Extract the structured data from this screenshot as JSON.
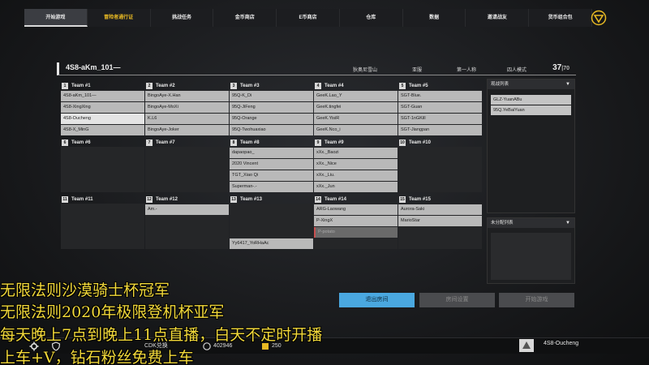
{
  "nav": {
    "tabs": [
      "开始游戏",
      "冒险者通行证",
      "挑战任务",
      "金币商店",
      "E币商店",
      "仓库",
      "数据",
      "邀请战友",
      "货币组合包"
    ],
    "active_index": 0,
    "highlight_index": 1,
    "highlight_color": "#e8b923",
    "logo_icon": "triangle-logo-icon"
  },
  "room": {
    "name": "4S8-aKm_101—",
    "map": "狄奥尼雪山",
    "region": "亚服",
    "perspective": "第一人称",
    "mode": "四人模式",
    "player_count": "37",
    "max_players": "70"
  },
  "teams": [
    {
      "num": "1",
      "label": "Team #1",
      "players": [
        "4S8-aKm_101—",
        "4S8-XingXing",
        "4S8-Oucheng",
        "4S8-X_MinG"
      ]
    },
    {
      "num": "2",
      "label": "Team #2",
      "players": [
        "BingoAye-X.Han",
        "BingoAye-MoXi",
        "K.L6",
        "BingoAye-Joker"
      ]
    },
    {
      "num": "3",
      "label": "Team #3",
      "players": [
        "95Q-K_Di",
        "95Q-JiFeng",
        "95Q-Orange",
        "95Q-Twohuaxiao"
      ]
    },
    {
      "num": "4",
      "label": "Team #4",
      "players": [
        "GeeK.Lao_Y",
        "GeeK.tingfei",
        "GeeK.YisiR",
        "GeeK.Nco_i"
      ]
    },
    {
      "num": "5",
      "label": "Team #5",
      "players": [
        "SGT-Blue.",
        "SGT-Guan",
        "SGT-1nGKill",
        "SGT-Jiangpan"
      ]
    },
    {
      "num": "6",
      "label": "Team #6",
      "players": [
        "",
        "",
        "",
        ""
      ]
    },
    {
      "num": "7",
      "label": "Team #7",
      "players": [
        "",
        "",
        "",
        ""
      ]
    },
    {
      "num": "8",
      "label": "Team #8",
      "players": [
        "dapaopao_",
        "2020 Vincent",
        "TGT_Xiao Qi",
        "Superman-.-"
      ]
    },
    {
      "num": "9",
      "label": "Team #9",
      "players": [
        "xXx._Baozi",
        "xXx._Nice",
        "xXx._Liu.",
        "xXx._Jun"
      ]
    },
    {
      "num": "10",
      "label": "Team #10",
      "players": [
        "",
        "",
        "",
        ""
      ]
    },
    {
      "num": "11",
      "label": "Team #11",
      "players": [
        "",
        "",
        "",
        ""
      ]
    },
    {
      "num": "12",
      "label": "Team #12",
      "players": [
        "Am.-",
        "",
        "",
        ""
      ]
    },
    {
      "num": "13",
      "label": "Team #13",
      "players": [
        "",
        "",
        "",
        "Yy6417_YoRHaAc"
      ]
    },
    {
      "num": "14",
      "label": "Team #14",
      "players": [
        "ARG-Laowang",
        "P-XingX",
        "P-potato",
        ""
      ]
    },
    {
      "num": "15",
      "label": "Team #15",
      "players": [
        "Aurora-Saki",
        "MarioStar",
        "",
        ""
      ]
    }
  ],
  "observers": {
    "title": "观战列表",
    "items": [
      "GLZ-YuanABu",
      "95Q.YeBaiYuan"
    ]
  },
  "unassigned": {
    "title": "未分配列表"
  },
  "actions": {
    "exit": "退出房间",
    "settings": "房间设置",
    "start": "开始游戏"
  },
  "bottombar": {
    "cdk": "CDK兑换",
    "coins": "402946",
    "ecoins": "250",
    "player": "4S8-Oucheng"
  },
  "captions": [
    "无限法则沙漠骑士杯冠军",
    "无限法则2020年极限登机杯亚军",
    "每天晚上7点到晚上11点直播，白天不定时开播",
    "上车+V，钻石粉丝免费上车"
  ]
}
